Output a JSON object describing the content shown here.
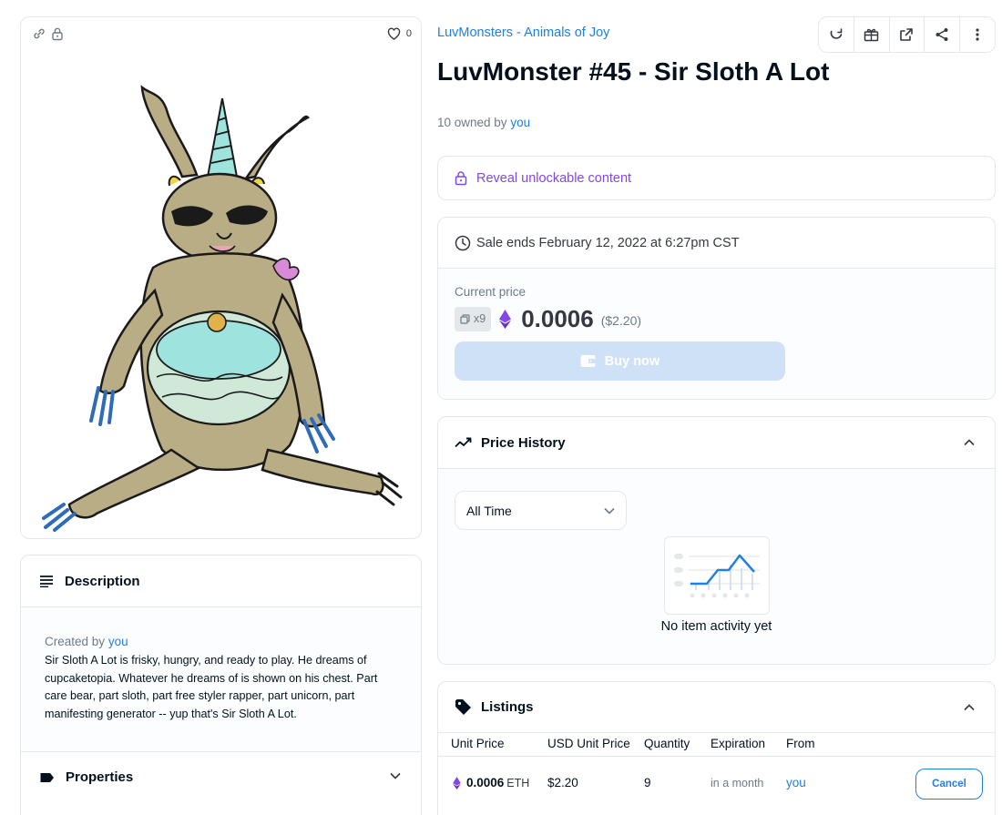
{
  "image_panel": {
    "favorite_count": "0"
  },
  "collection": {
    "name": "LuvMonsters - Animals of Joy"
  },
  "item": {
    "title": "LuvMonster #45 - Sir Sloth A Lot",
    "owned_prefix": "10 owned by",
    "owned_by": "you"
  },
  "unlockable": {
    "label": "Reveal unlockable content"
  },
  "sale": {
    "ends_label": "Sale ends February 12, 2022 at 6:27pm CST",
    "current_price_label": "Current price",
    "quantity_badge": "x9",
    "price": "0.0006",
    "price_usd": "($2.20)",
    "buy_label": "Buy now"
  },
  "price_history": {
    "title": "Price History",
    "range_selected": "All Time",
    "empty_text": "No item activity yet"
  },
  "description": {
    "title": "Description",
    "created_prefix": "Created by",
    "creator": "you",
    "text": "Sir Sloth A Lot is frisky, hungry, and ready to play. He dreams of cupcaketopia. Whatever he dreams of is shown on his chest. Part care bear, part sloth, part free styler rapper, part unicorn, part manifesting generator -- yup that's Sir Sloth A Lot."
  },
  "properties": {
    "title": "Properties"
  },
  "listings": {
    "title": "Listings",
    "columns": [
      "Unit Price",
      "USD Unit Price",
      "Quantity",
      "Expiration",
      "From"
    ],
    "rows": [
      {
        "price": "0.0006",
        "currency": "ETH",
        "usd": "$2.20",
        "quantity": "9",
        "expiration": "in a month",
        "from": "you",
        "action": "Cancel"
      }
    ]
  },
  "colors": {
    "accent": "#2081e2",
    "buy_disabled": "#cfe1f7",
    "unlockable_purple": "#8247e5",
    "border": "#e5e8eb",
    "panel_bg": "#fbfdff"
  },
  "icons": [
    "link-icon",
    "lock-icon",
    "heart-icon",
    "refresh-icon",
    "gift-icon",
    "external-link-icon",
    "share-icon",
    "more-icon",
    "clock-icon",
    "eth-icon",
    "wallet-icon",
    "trend-icon",
    "chevron-up-icon",
    "chevron-down-icon",
    "description-icon",
    "tag-icon",
    "label-icon"
  ]
}
